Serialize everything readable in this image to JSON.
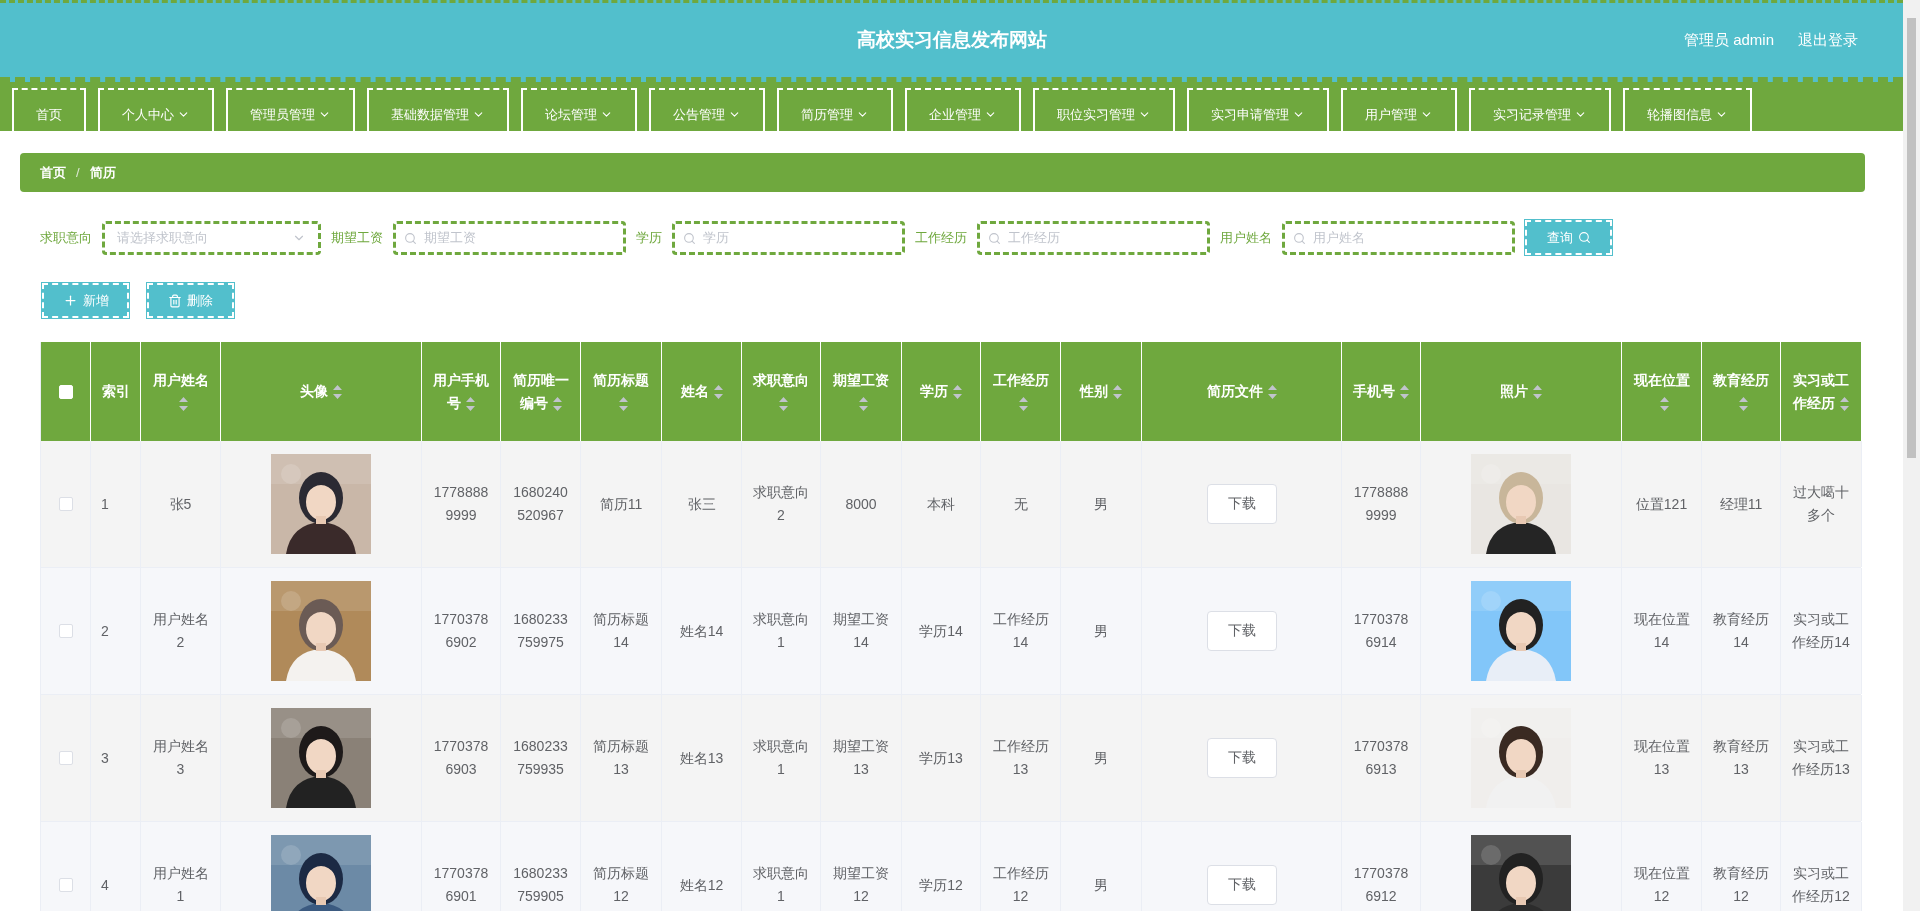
{
  "header": {
    "title": "高校实习信息发布网站",
    "user": "管理员 admin",
    "logout": "退出登录"
  },
  "nav": [
    {
      "label": "首页",
      "dropdown": false
    },
    {
      "label": "个人中心",
      "dropdown": true
    },
    {
      "label": "管理员管理",
      "dropdown": true
    },
    {
      "label": "基础数据管理",
      "dropdown": true
    },
    {
      "label": "论坛管理",
      "dropdown": true
    },
    {
      "label": "公告管理",
      "dropdown": true
    },
    {
      "label": "简历管理",
      "dropdown": true
    },
    {
      "label": "企业管理",
      "dropdown": true
    },
    {
      "label": "职位实习管理",
      "dropdown": true
    },
    {
      "label": "实习申请管理",
      "dropdown": true
    },
    {
      "label": "用户管理",
      "dropdown": true
    },
    {
      "label": "实习记录管理",
      "dropdown": true
    },
    {
      "label": "轮播图信息",
      "dropdown": true
    }
  ],
  "breadcrumb": {
    "items": [
      "首页",
      "简历"
    ],
    "separator": "/"
  },
  "filters": [
    {
      "label": "求职意向",
      "kind": "select",
      "placeholder": "请选择求职意向"
    },
    {
      "label": "期望工资",
      "kind": "input",
      "placeholder": "期望工资"
    },
    {
      "label": "学历",
      "kind": "input",
      "placeholder": "学历"
    },
    {
      "label": "工作经历",
      "kind": "input",
      "placeholder": "工作经历"
    },
    {
      "label": "用户姓名",
      "kind": "input",
      "placeholder": "用户姓名"
    }
  ],
  "query_button": "查询",
  "actions": [
    {
      "kind": "add",
      "label": "新增"
    },
    {
      "kind": "delete",
      "label": "删除"
    }
  ],
  "table": {
    "select_all": {
      "checked": false
    },
    "columns": [
      {
        "label": "索引",
        "kind": "text",
        "sortable": false
      },
      {
        "label": "用户姓名",
        "kind": "text",
        "sortable": true
      },
      {
        "label": "头像",
        "kind": "picture",
        "sortable": true
      },
      {
        "label": "用户手机号",
        "kind": "text",
        "sortable": true
      },
      {
        "label": "简历唯一编号",
        "kind": "text",
        "sortable": true
      },
      {
        "label": "简历标题",
        "kind": "text",
        "sortable": true
      },
      {
        "label": "姓名",
        "kind": "text",
        "sortable": true
      },
      {
        "label": "求职意向",
        "kind": "text",
        "sortable": true
      },
      {
        "label": "期望工资",
        "kind": "text",
        "sortable": true
      },
      {
        "label": "学历",
        "kind": "text",
        "sortable": true
      },
      {
        "label": "工作经历",
        "kind": "text",
        "sortable": true
      },
      {
        "label": "性别",
        "kind": "text",
        "sortable": true
      },
      {
        "label": "简历文件",
        "kind": "file",
        "sortable": true
      },
      {
        "label": "手机号",
        "kind": "text",
        "sortable": true
      },
      {
        "label": "照片",
        "kind": "picture",
        "sortable": true
      },
      {
        "label": "现在位置",
        "kind": "text",
        "sortable": true
      },
      {
        "label": "教育经历",
        "kind": "text",
        "sortable": true
      },
      {
        "label": "实习或工作经历",
        "kind": "text",
        "sortable": true
      }
    ],
    "rows": [
      {
        "checked": false,
        "cells": [
          "1",
          "张5",
          {
            "kind": "picture"
          },
          "17788889999",
          "1680240520967",
          "简历11",
          "张三",
          "求职意向2",
          "8000",
          "本科",
          "无",
          "男",
          "下载",
          "17788889999",
          {
            "kind": "picture"
          },
          "位置121",
          "经理11",
          "过大噶十多个"
        ]
      },
      {
        "checked": false,
        "cells": [
          "2",
          "用户姓名2",
          {
            "kind": "picture"
          },
          "17703786902",
          "1680233759975",
          "简历标题14",
          "姓名14",
          "求职意向1",
          "期望工资14",
          "学历14",
          "工作经历14",
          "男",
          "下载",
          "17703786914",
          {
            "kind": "picture"
          },
          "现在位置14",
          "教育经历14",
          "实习或工作经历14"
        ]
      },
      {
        "checked": false,
        "cells": [
          "3",
          "用户姓名3",
          {
            "kind": "picture"
          },
          "17703786903",
          "1680233759935",
          "简历标题13",
          "姓名13",
          "求职意向1",
          "期望工资13",
          "学历13",
          "工作经历13",
          "男",
          "下载",
          "17703786913",
          {
            "kind": "picture"
          },
          "现在位置13",
          "教育经历13",
          "实习或工作经历13"
        ]
      },
      {
        "checked": false,
        "cells": [
          "4",
          "用户姓名1",
          {
            "kind": "picture"
          },
          "17703786901",
          "1680233759905",
          "简历标题12",
          "姓名12",
          "求职意向1",
          "期望工资12",
          "学历12",
          "工作经历12",
          "男",
          "下载",
          "17703786912",
          {
            "kind": "picture"
          },
          "现在位置12",
          "教育经历12",
          "实习或工作经历12"
        ]
      }
    ]
  }
}
